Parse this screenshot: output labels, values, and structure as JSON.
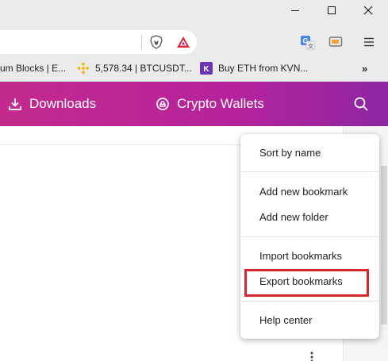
{
  "window": {
    "controls": {
      "minimize": "minimize-icon",
      "maximize": "maximize-icon",
      "close": "close-icon"
    }
  },
  "toolbar": {
    "icons": [
      "brave-shields-icon",
      "brave-rewards-icon",
      "google-translate-icon",
      "cast-extension-icon",
      "browser-menu-icon"
    ]
  },
  "bookmarks_bar": {
    "items": [
      {
        "label": "um Blocks | E...",
        "icon": ""
      },
      {
        "label": "5,578.34 | BTCUSDT...",
        "icon": "binance-icon"
      },
      {
        "label": "Buy ETH from KVN...",
        "icon": "kvn-icon"
      }
    ],
    "more_label": "»"
  },
  "header": {
    "downloads_label": "Downloads",
    "crypto_wallets_label": "Crypto Wallets",
    "search_icon": "search-icon",
    "accent_start": "#c42a8d",
    "accent_end": "#8e26a3"
  },
  "menu": {
    "sort_by_name": "Sort by name",
    "add_new_bookmark": "Add new bookmark",
    "add_new_folder": "Add new folder",
    "import_bookmarks": "Import bookmarks",
    "export_bookmarks": "Export bookmarks",
    "help_center": "Help center",
    "highlight_color": "#d6262e"
  }
}
